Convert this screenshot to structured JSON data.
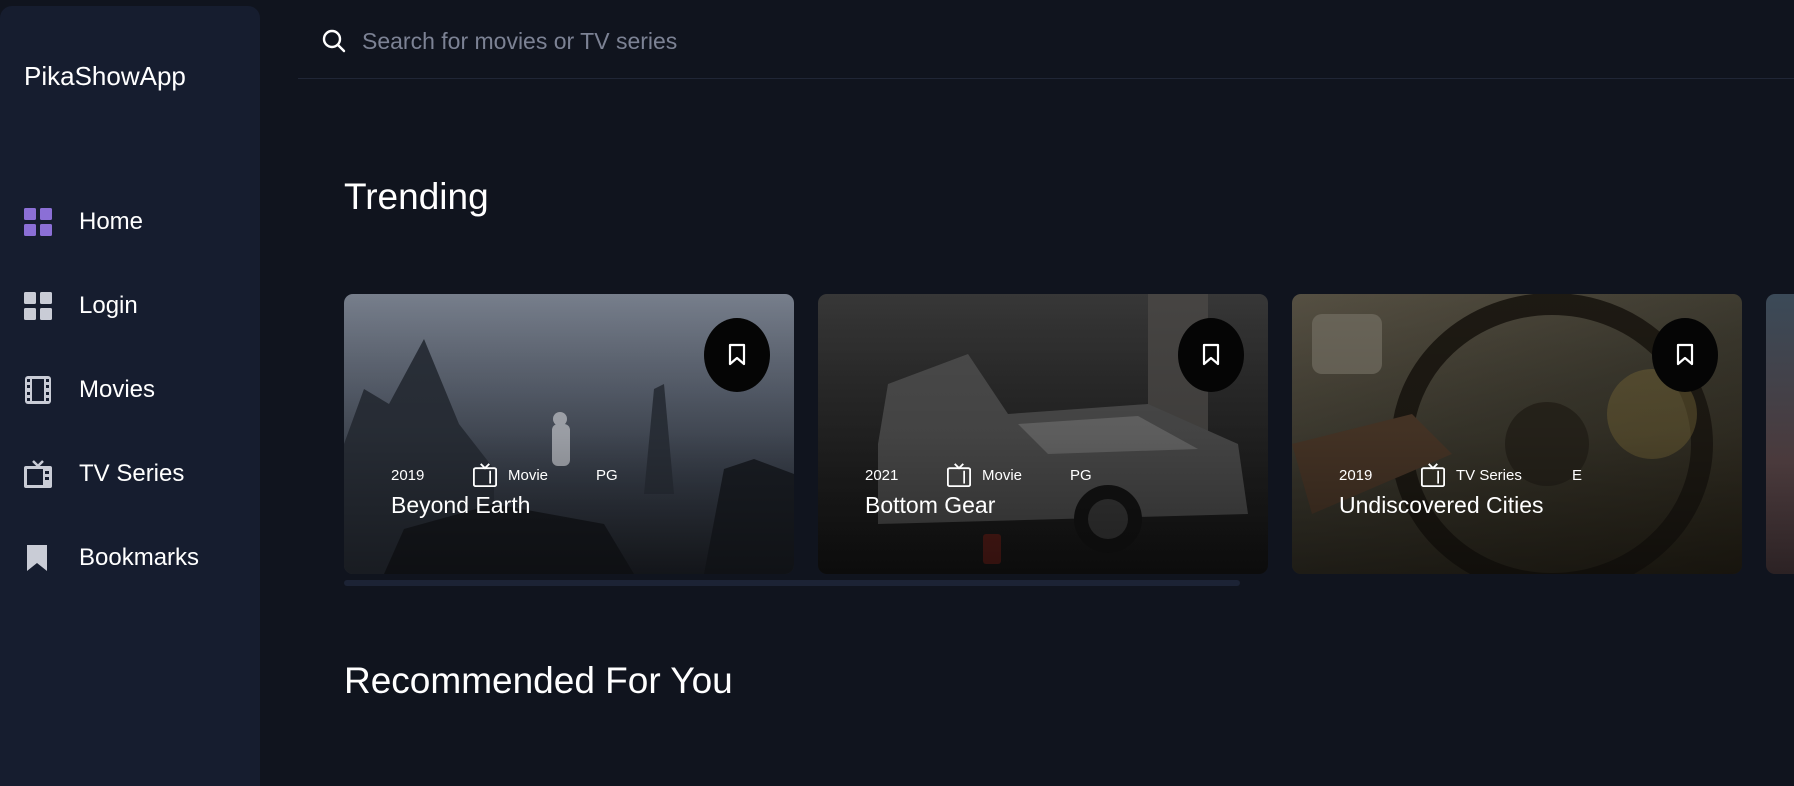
{
  "brand": "PikaShowApp",
  "nav": [
    {
      "label": "Home",
      "icon": "grid-icon",
      "active": true
    },
    {
      "label": "Login",
      "icon": "grid-icon",
      "active": false
    },
    {
      "label": "Movies",
      "icon": "film-icon",
      "active": false
    },
    {
      "label": "TV Series",
      "icon": "tv-icon",
      "active": false
    },
    {
      "label": "Bookmarks",
      "icon": "bookmark-icon",
      "active": false
    }
  ],
  "search": {
    "placeholder": "Search for movies or TV series"
  },
  "sections": {
    "trending": "Trending",
    "recommended": "Recommended For You"
  },
  "trending": [
    {
      "year": "2019",
      "category": "Movie",
      "rating": "PG",
      "title": "Beyond Earth"
    },
    {
      "year": "2021",
      "category": "Movie",
      "rating": "PG",
      "title": "Bottom Gear"
    },
    {
      "year": "2019",
      "category": "TV Series",
      "rating": "E",
      "title": "Undiscovered Cities"
    }
  ],
  "colors": {
    "background": "#10141e",
    "sidebar": "#161d2f",
    "accent": "#8b6fd6",
    "icon_inactive": "#c9ccd6"
  }
}
